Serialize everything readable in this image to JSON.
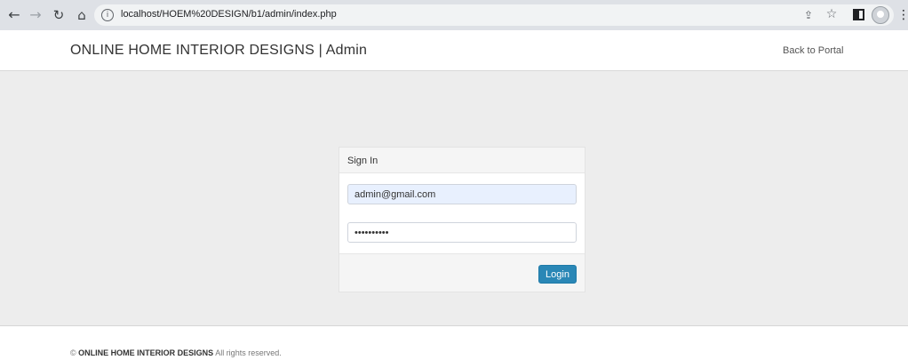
{
  "browser": {
    "url": "localhost/HOEM%20DESIGN/b1/admin/index.php",
    "icons": [
      "back-arrow-icon",
      "forward-arrow-icon",
      "reload-icon",
      "home-icon",
      "info-icon",
      "share-icon",
      "star-icon",
      "sidebar-icon",
      "profile-icon",
      "menu-icon"
    ]
  },
  "header": {
    "brand": "ONLINE HOME INTERIOR DESIGNS | Admin",
    "back_link": "Back to Portal"
  },
  "login": {
    "title": "Sign In",
    "email_value": "admin@gmail.com",
    "password_value": "••••••••••",
    "button_label": "Login"
  },
  "footer": {
    "copyright_symbol": "©",
    "brand": "ONLINE HOME INTERIOR DESIGNS",
    "rights": "All rights reserved."
  },
  "colors": {
    "browser_chrome": "#dee1e6",
    "band_background": "#ededed",
    "login_button": "#2a87b6",
    "autofill_field": "#e8f0fe"
  }
}
